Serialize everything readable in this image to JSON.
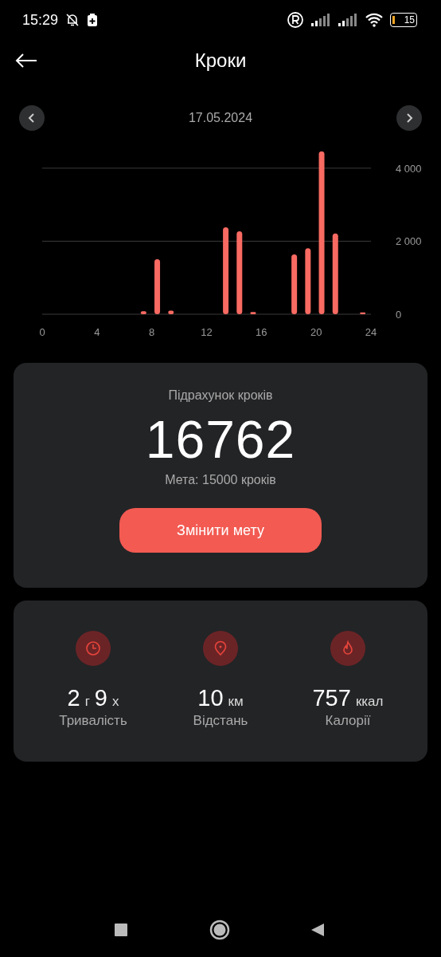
{
  "status_bar": {
    "time": "15:29",
    "battery": "15"
  },
  "header": {
    "title": "Кроки"
  },
  "date_nav": {
    "date": "17.05.2024"
  },
  "chart": {
    "chart_data": {
      "type": "bar",
      "x": [
        7.4,
        8.4,
        9.4,
        13.4,
        14.4,
        15.4,
        18.4,
        19.4,
        20.4,
        21.4,
        23.4
      ],
      "values": [
        80,
        1510,
        100,
        2380,
        2270,
        60,
        1640,
        1810,
        4460,
        2210,
        50
      ],
      "xlim": [
        0,
        24
      ],
      "ylim": [
        0,
        4500
      ],
      "xticks": [
        0,
        4,
        8,
        12,
        16,
        20,
        24
      ],
      "yticks": [
        0,
        {
          "value": 2000,
          "label": "2 000"
        },
        {
          "value": 4000,
          "label": "4 000"
        }
      ]
    }
  },
  "steps_card": {
    "label": "Підрахунок кроків",
    "count": "16762",
    "goal": "Мета: 15000 кроків",
    "button": "Змінити мету"
  },
  "stats": [
    {
      "kind": "clock",
      "parts": [
        {
          "value": "2",
          "unit": "г"
        },
        {
          "value": "9",
          "unit": "х"
        }
      ],
      "label": "Тривалість"
    },
    {
      "kind": "pin",
      "parts": [
        {
          "value": "10",
          "unit": "км"
        }
      ],
      "label": "Відстань"
    },
    {
      "kind": "flame",
      "parts": [
        {
          "value": "757",
          "unit": "ккал"
        }
      ],
      "label": "Калорії"
    }
  ]
}
